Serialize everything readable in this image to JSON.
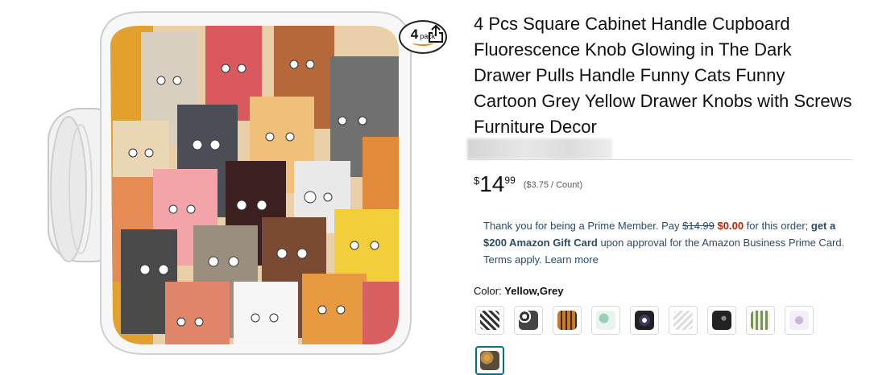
{
  "product": {
    "pack_count": "4",
    "pack_word": "pack",
    "title": "4 Pcs Square Cabinet Handle Cupboard Fluorescence Knob Glowing in The Dark Drawer Pulls Handle Funny Cats Funny Cartoon Grey Yellow Drawer Knobs with Screws Furniture Decor"
  },
  "price": {
    "symbol": "$",
    "whole": "14",
    "fraction": "99",
    "per_unit": "($3.75 / Count)"
  },
  "prime_offer": {
    "text1": "Thank you for being a Prime Member. Pay ",
    "strike_price": "$14.99",
    "zero_price": "$0.00",
    "text2": " for this order; ",
    "bold_text": "get a $200 Amazon Gift Card",
    "text3": " upon approval for the Amazon Business Prime Card. Terms apply. ",
    "learn_more": "Learn more"
  },
  "color": {
    "label": "Color: ",
    "selected": "Yellow,Grey"
  },
  "swatches": [
    {
      "name": "swatch-1",
      "color": "#3a3a3a"
    },
    {
      "name": "swatch-2",
      "color": "#4a4a55"
    },
    {
      "name": "swatch-3",
      "color": "#c87a2a"
    },
    {
      "name": "swatch-4",
      "color": "#9ccfb8"
    },
    {
      "name": "swatch-5",
      "color": "#3c3a66"
    },
    {
      "name": "swatch-6",
      "color": "#c9c9c9"
    },
    {
      "name": "swatch-7",
      "color": "#222222"
    },
    {
      "name": "swatch-8",
      "color": "#7a8f5a"
    },
    {
      "name": "swatch-9",
      "color": "#c8b8d8"
    },
    {
      "name": "swatch-10-selected",
      "color": "#b58a4e"
    }
  ],
  "icons": {
    "share": "share-icon",
    "amazon_smile": "amazon-smile-icon"
  }
}
